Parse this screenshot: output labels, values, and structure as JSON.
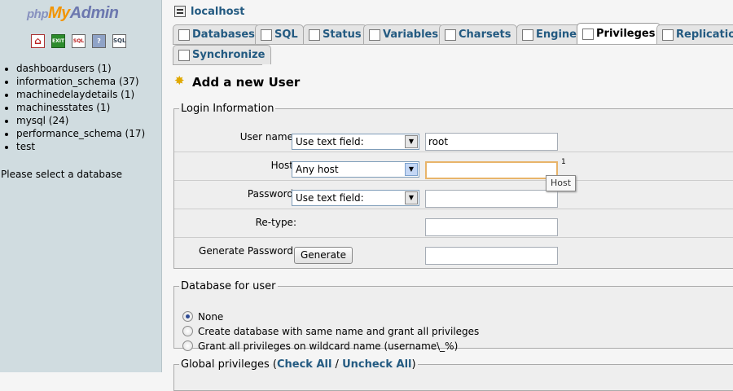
{
  "left": {
    "logo": {
      "php": "php",
      "my": "My",
      "admin": "Admin"
    },
    "nav_icons": [
      "home-icon",
      "logout-icon",
      "query-window-icon",
      "documentation-icon",
      "sql-docs-icon"
    ],
    "databases": [
      "dashboardusers (1)",
      "information_schema (37)",
      "machinedelaydetails (1)",
      "machinesstates (1)",
      "mysql (24)",
      "performance_schema (17)",
      "test"
    ],
    "hint": "Please select a database"
  },
  "header": {
    "server": "localhost"
  },
  "tabs": [
    "Databases",
    "SQL",
    "Status",
    "Variables",
    "Charsets",
    "Engines",
    "Privileges",
    "Replication",
    "Synchronize"
  ],
  "active_tab": "Privileges",
  "heading": "Add a new User",
  "login": {
    "legend": "Login Information",
    "user_label": "User name:",
    "user_select": "Use text field:",
    "user_value": "root",
    "host_label": "Host:",
    "host_select": "Any host",
    "host_value": "",
    "host_note": "1",
    "password_label": "Password:",
    "password_select": "Use text field:",
    "retype_label": "Re-type:",
    "generate_label": "Generate Password:",
    "generate_button": "Generate",
    "tooltip": "Host"
  },
  "db_for_user": {
    "legend": "Database for user",
    "options": [
      "None",
      "Create database with same name and grant all privileges",
      "Grant all privileges on wildcard name (username\\_%)"
    ],
    "selected": 0
  },
  "global": {
    "legend_prefix": "Global privileges (",
    "check_all": "Check All",
    "sep": " / ",
    "uncheck_all": "Uncheck All",
    "legend_suffix": ")"
  },
  "colors": {
    "left_bg": "#d0dce0",
    "link": "#235a81",
    "focus_border": "#e8b46a"
  }
}
